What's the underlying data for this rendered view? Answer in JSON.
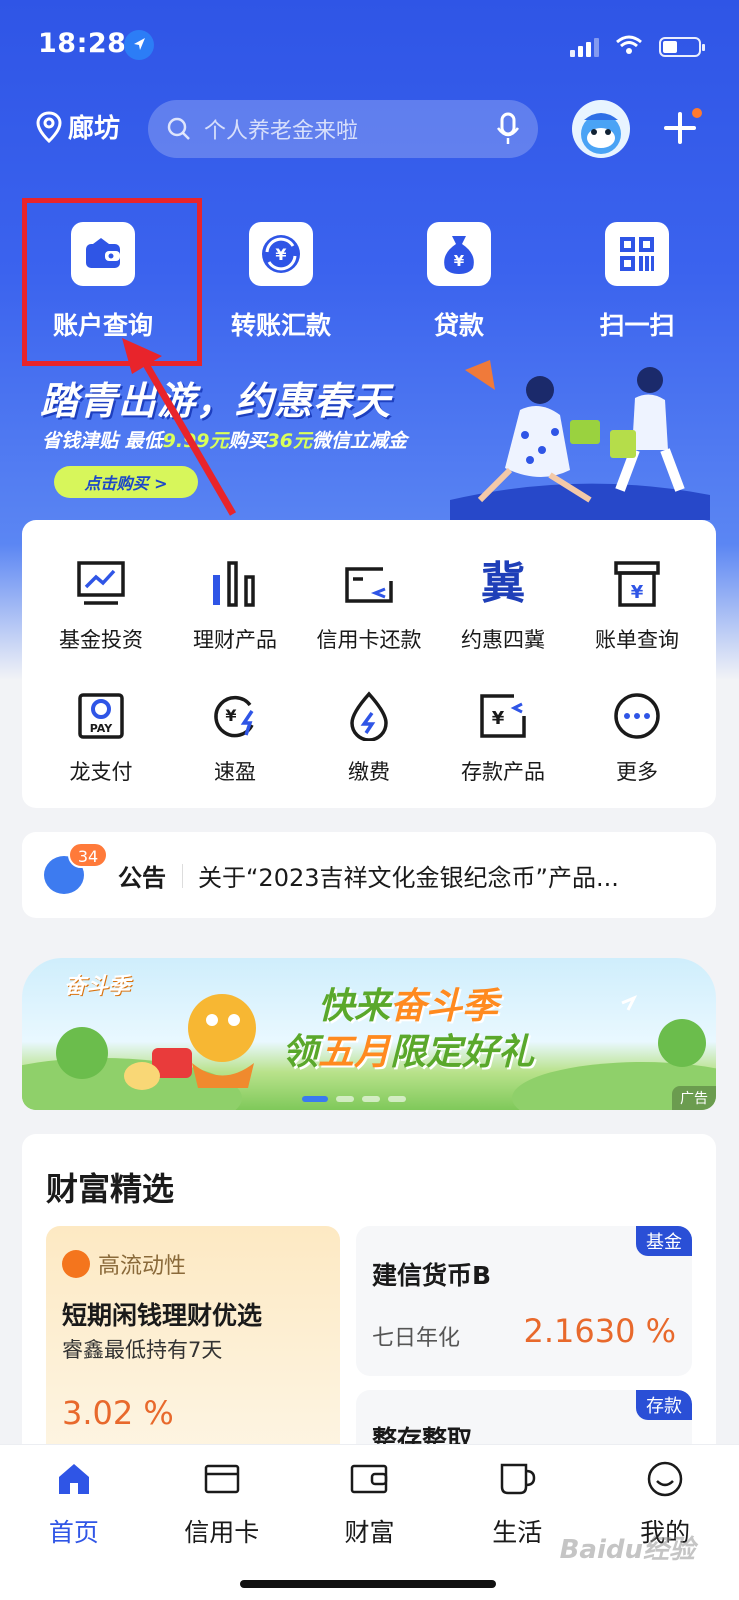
{
  "status_bar": {
    "time": "18:28"
  },
  "header": {
    "city": "廊坊",
    "search_placeholder": "个人养老金来啦"
  },
  "quick_actions": [
    {
      "label": "账户查询",
      "icon": "wallet-icon"
    },
    {
      "label": "转账汇款",
      "icon": "transfer-icon"
    },
    {
      "label": "贷款",
      "icon": "money-bag-icon"
    },
    {
      "label": "扫一扫",
      "icon": "scan-icon"
    }
  ],
  "banner": {
    "title": "踏青出游，约惠春天",
    "subtitle_prefix": "省钱津贴 最低",
    "subtitle_price": "9.99元",
    "subtitle_mid": "购买",
    "subtitle_value": "36元",
    "subtitle_suffix": "微信立减金",
    "button": "点击购买 >"
  },
  "services": [
    {
      "label": "基金投资",
      "icon": "chart-icon"
    },
    {
      "label": "理财产品",
      "icon": "bars-icon"
    },
    {
      "label": "信用卡还款",
      "icon": "card-repay-icon"
    },
    {
      "label": "约惠四冀",
      "icon": "ji-character-icon"
    },
    {
      "label": "账单查询",
      "icon": "bill-icon"
    },
    {
      "label": "龙支付",
      "icon": "pay-icon"
    },
    {
      "label": "速盈",
      "icon": "quick-yield-icon"
    },
    {
      "label": "缴费",
      "icon": "payment-drop-icon"
    },
    {
      "label": "存款产品",
      "icon": "deposit-icon"
    },
    {
      "label": "更多",
      "icon": "more-icon"
    }
  ],
  "notice": {
    "badge": "34",
    "label": "公告",
    "text": "关于“2023吉祥文化金银纪念币”产品..."
  },
  "ad": {
    "logo": "奋斗季",
    "line1_a": "快来",
    "line1_b": "奋斗季",
    "line2_a": "领",
    "line2_b": "五月",
    "line2_c": "限定好礼",
    "tag": "广告"
  },
  "wealth": {
    "title": "财富精选",
    "featured": {
      "tag": "高流动性",
      "name": "短期闲钱理财优选",
      "sub": "睿鑫最低持有7天",
      "rate": "3.02 %"
    },
    "items": [
      {
        "corner": "基金",
        "name": "建信货币B",
        "rate_label": "七日年化",
        "rate": "2.1630 %"
      },
      {
        "corner": "存款",
        "name": "整存整取"
      }
    ]
  },
  "tabbar": [
    {
      "label": "首页",
      "icon": "home-icon",
      "active": true
    },
    {
      "label": "信用卡",
      "icon": "credit-card-icon"
    },
    {
      "label": "财富",
      "icon": "wealth-wallet-icon"
    },
    {
      "label": "生活",
      "icon": "cup-icon"
    },
    {
      "label": "我的",
      "icon": "smile-icon"
    }
  ],
  "watermark": "Baidu经验",
  "colors": {
    "primary": "#2f55e6",
    "accent_orange": "#e8692c",
    "highlight_red": "#e8242b"
  }
}
